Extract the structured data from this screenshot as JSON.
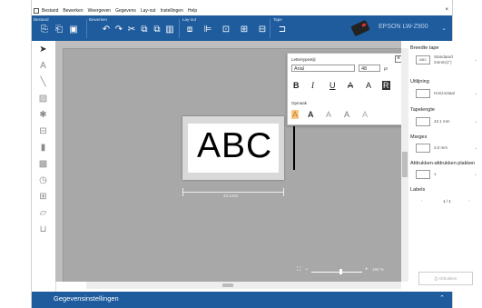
{
  "menu": [
    "Bestand",
    "Bewerken",
    "Weergeven",
    "Gegevens",
    "Lay-out",
    "Instellingen",
    "Help"
  ],
  "ribbon": {
    "groups": [
      "Bestand",
      "Bewerken",
      "Lay-out",
      "Tape"
    ],
    "printer_name": "EPSON LW-Z900"
  },
  "font_panel": {
    "title": "Lettertypestijl",
    "font_name": "Arial",
    "font_size": "48",
    "unit": "pt",
    "format_buttons": [
      "B",
      "I",
      "U",
      "A",
      "A",
      "R"
    ],
    "effects_label": "Opmaak",
    "effects": [
      "A",
      "A",
      "A",
      "A",
      "A"
    ]
  },
  "canvas": {
    "tape_text": "ABC",
    "tape_length_label": "43.1mm",
    "zoom_percent": "150 %"
  },
  "properties": {
    "tape_width_label": "Breedte tape",
    "tape_width_icon": "ABC",
    "tape_width_value_line1": "Standaard",
    "tape_width_value_line2": "24mm(1\")",
    "alignment_label": "Uitlijning",
    "alignment_value": "Horizontaal",
    "tape_length_label": "Tapelengte",
    "tape_length_value": "43.1 mm",
    "margins_label": "Marges",
    "margins_value": "3.0 mm",
    "copies_label": "Afdrukken-afdrukken plakken",
    "copies_value": "1",
    "labels_label": "Labels",
    "labels_value": "1 / 1",
    "print_button": "Afdrukken"
  },
  "statusbar": {
    "title": "Gegevensinstellingen"
  }
}
